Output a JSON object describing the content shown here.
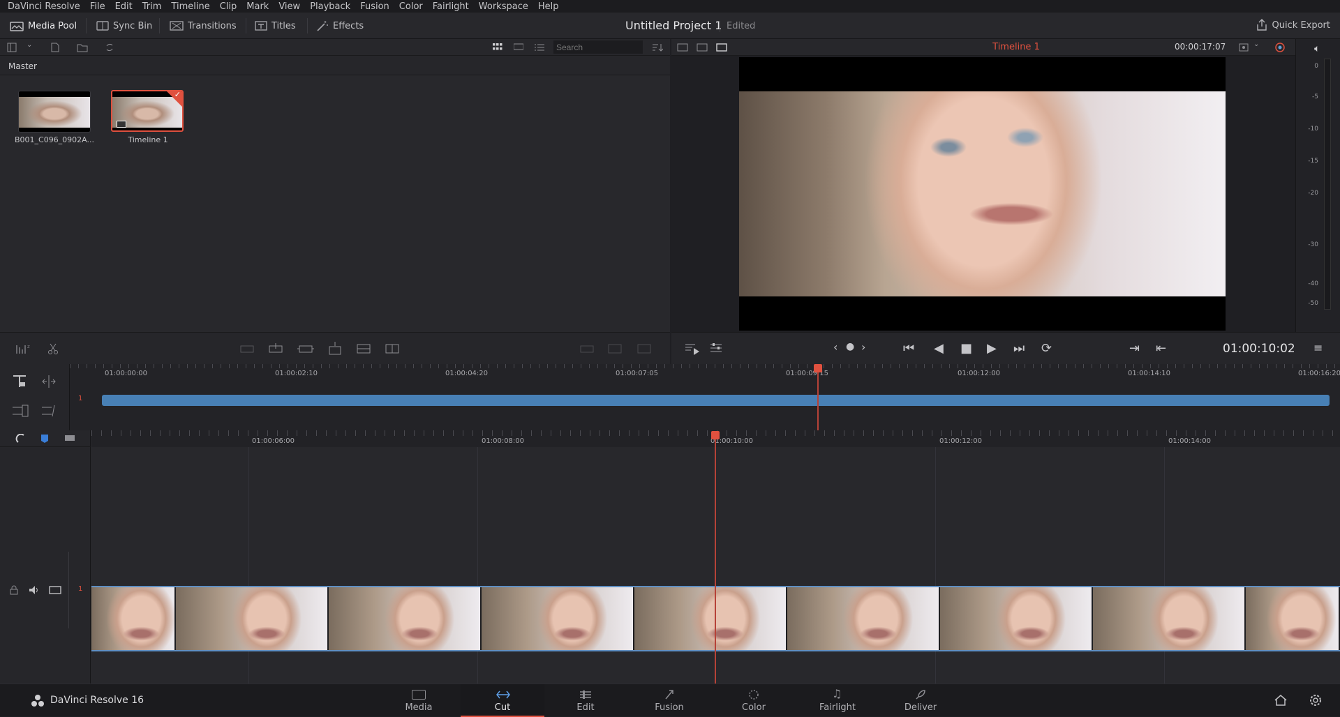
{
  "menubar": {
    "app": "DaVinci Resolve",
    "items": [
      "File",
      "Edit",
      "Trim",
      "Timeline",
      "Clip",
      "Mark",
      "View",
      "Playback",
      "Fusion",
      "Color",
      "Fairlight",
      "Workspace",
      "Help"
    ]
  },
  "toolbar": {
    "media_pool": "Media Pool",
    "sync_bin": "Sync Bin",
    "transitions": "Transitions",
    "titles": "Titles",
    "effects": "Effects",
    "project_title": "Untitled Project 1",
    "project_status": "Edited",
    "quick_export": "Quick Export"
  },
  "media_pool": {
    "search_placeholder": "Search",
    "bin": "Master",
    "clips": [
      {
        "name": "B001_C096_0902A..."
      },
      {
        "name": "Timeline 1",
        "selected": true
      }
    ]
  },
  "viewer": {
    "timeline_name": "Timeline 1",
    "duration": "00:00:17:07",
    "timecode": "01:00:10:02",
    "accent": "#e0513f"
  },
  "audio_meter": {
    "labels": [
      "0",
      "-5",
      "-10",
      "-15",
      "-20",
      "-30",
      "-40",
      "-50"
    ]
  },
  "upper_timeline": {
    "ticks": [
      "01:00:00:00",
      "01:00:02:10",
      "01:00:04:20",
      "01:00:07:05",
      "01:00:09:15",
      "01:00:12:00",
      "01:00:14:10",
      "01:00:16:20"
    ],
    "track_number": "1",
    "clip_color": "#4880b5"
  },
  "lower_timeline": {
    "ticks": [
      "01:00:06:00",
      "01:00:08:00",
      "01:00:10:00",
      "01:00:12:00",
      "01:00:14:00"
    ],
    "track_number": "1"
  },
  "bottom": {
    "brand": "DaVinci Resolve 16",
    "pages": [
      "Media",
      "Cut",
      "Edit",
      "Fusion",
      "Color",
      "Fairlight",
      "Deliver"
    ],
    "active_page": "Cut"
  }
}
